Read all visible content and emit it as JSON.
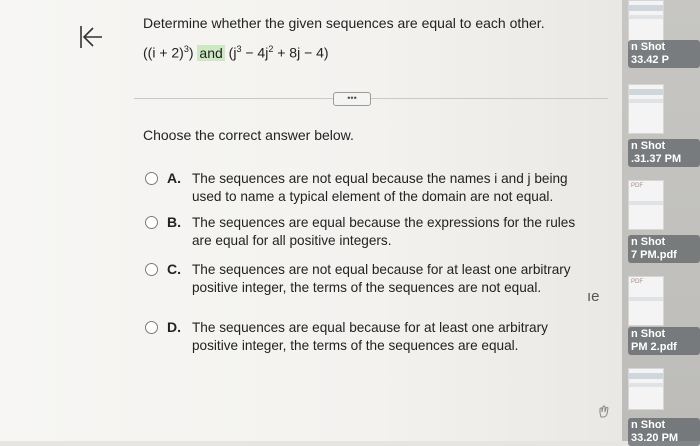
{
  "question": {
    "text": "Determine whether the given sequences are equal to each other.",
    "formula": {
      "left": "((i + 2)",
      "left_exp": "3",
      "left_close": ")",
      "and": "and",
      "right_open": "(j",
      "right_exp1": "3",
      "right_mid": " − 4j",
      "right_exp2": "2",
      "right_end": " + 8j − 4)"
    }
  },
  "more_button": "•••",
  "prompt": "Choose the correct answer below.",
  "choices": [
    {
      "letter": "A.",
      "text": "The sequences are not equal because the names i and j being used to name a typical element of the domain are not equal."
    },
    {
      "letter": "B.",
      "text": "The sequences are equal because the expressions for the rules are equal for all positive integers."
    },
    {
      "letter": "C.",
      "text": "The sequences are not equal because for at least one arbitrary positive integer, the terms of the sequences are not equal."
    },
    {
      "letter": "D.",
      "text": "The sequences are equal because for at least one arbitrary positive integer, the terms of the sequences are equal."
    }
  ],
  "edge_text": "ıe",
  "desktop_files": [
    {
      "line1": "n Shot",
      "line2": "33.42 P"
    },
    {
      "line1": "n Shot",
      "line2": ".31.37 PM"
    },
    {
      "line1": "n Shot",
      "line2": "7 PM.pdf"
    },
    {
      "line1": "n Shot",
      "line2": "PM 2.pdf"
    },
    {
      "line1": "n Shot",
      "line2": "33.20 PM"
    }
  ],
  "colors": {
    "highlight": "#cfe8c4",
    "page": "#f5f4f2",
    "desktop": "#c2c1bd"
  }
}
